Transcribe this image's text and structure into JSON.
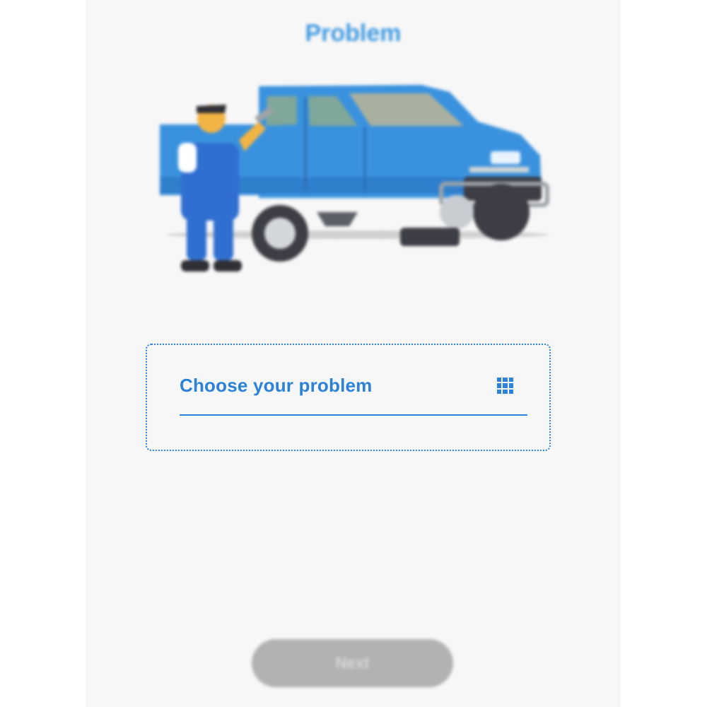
{
  "header": {
    "title": "Problem"
  },
  "illustration": {
    "name": "mechanic-with-pickup-truck-illustration"
  },
  "problem_selector": {
    "label": "Choose your problem",
    "icon": "grid-icon"
  },
  "footer": {
    "next_label": "Next"
  },
  "colors": {
    "accent": "#2b82d6",
    "title": "#3f9ae0",
    "truck": "#3a92de",
    "button_disabled": "#b2b2b2",
    "background": "#f7f7f7"
  }
}
